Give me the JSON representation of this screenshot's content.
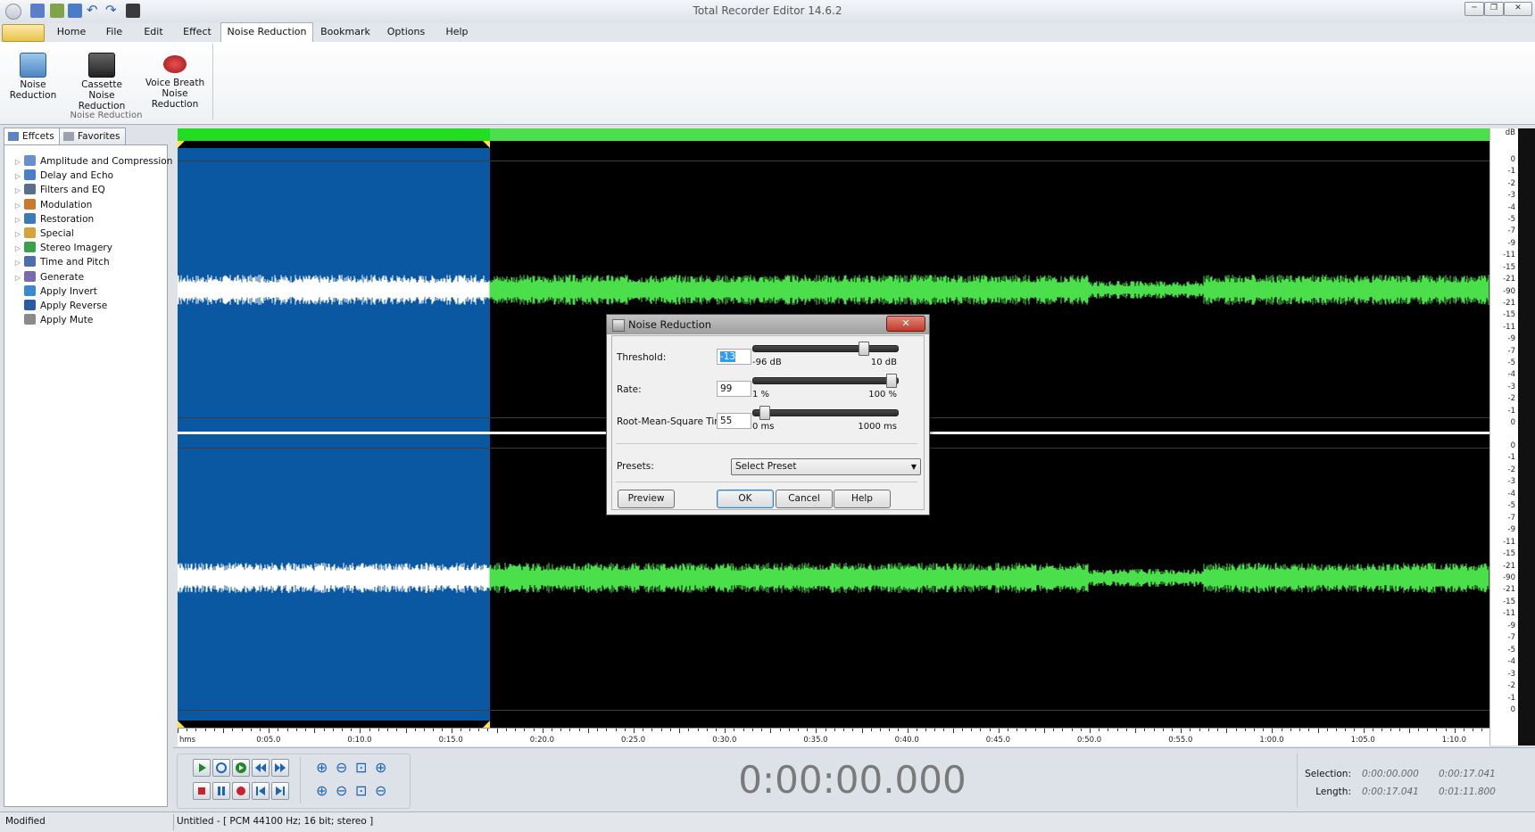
{
  "window": {
    "title": "Total Recorder Editor 14.6.2",
    "min_label": "─",
    "max_label": "❐",
    "close_label": "✕"
  },
  "ribbon": {
    "tabs": [
      "Home",
      "File",
      "Edit",
      "Effect",
      "Noise Reduction",
      "Bookmark",
      "Options",
      "Help"
    ],
    "active_tab": "Noise Reduction",
    "buttons": [
      {
        "label_1": "Noise",
        "label_2": "Reduction",
        "icon": "noise-reduction-icon"
      },
      {
        "label_1": "Cassette Noise",
        "label_2": "Reduction",
        "icon": "cassette-icon"
      },
      {
        "label_1": "Voice Breath",
        "label_2": "Noise Reduction",
        "icon": "lips-icon"
      }
    ],
    "group_label": "Noise Reduction"
  },
  "left_panel": {
    "tabs": [
      "Effcets",
      "Favorites"
    ],
    "items": [
      {
        "label": "Amplitude and Compression",
        "expandable": true
      },
      {
        "label": "Delay and Echo",
        "expandable": true
      },
      {
        "label": "Filters and EQ",
        "expandable": true
      },
      {
        "label": "Modulation",
        "expandable": true
      },
      {
        "label": "Restoration",
        "expandable": true
      },
      {
        "label": "Special",
        "expandable": true
      },
      {
        "label": "Stereo Imagery",
        "expandable": true
      },
      {
        "label": "Time and Pitch",
        "expandable": true
      },
      {
        "label": "Generate",
        "expandable": true
      },
      {
        "label": "Apply Invert",
        "expandable": false
      },
      {
        "label": "Apply Reverse",
        "expandable": false
      },
      {
        "label": "Apply Mute",
        "expandable": false
      }
    ]
  },
  "waveform": {
    "db_unit": "dB",
    "db_labels_top": [
      "0",
      "-1",
      "-2",
      "-3",
      "-4",
      "-5",
      "-7",
      "-9",
      "-11",
      "-15",
      "-21",
      "-90",
      "-21",
      "-15",
      "-11",
      "-9",
      "-7",
      "-5",
      "-4",
      "-3",
      "-2",
      "-1",
      "0"
    ],
    "db_labels_bottom": [
      "0",
      "-1",
      "-2",
      "-3",
      "-4",
      "-5",
      "-7",
      "-9",
      "-11",
      "-15",
      "-21",
      "-90",
      "-21",
      "-15",
      "-11",
      "-9",
      "-7",
      "-5",
      "-4",
      "-3",
      "-2",
      "-1",
      "0"
    ],
    "timeline_labels": [
      "hms",
      "0:05.0",
      "0:10.0",
      "0:15.0",
      "0:20.0",
      "0:25.0",
      "0:30.0",
      "0:35.0",
      "0:40.0",
      "0:45.0",
      "0:50.0",
      "0:55.0",
      "1:00.0",
      "1:05.0",
      "1:10.0"
    ],
    "colors": {
      "selection": "#0a57a2",
      "wave": "#4be04b",
      "wave_selected": "#ffffff",
      "background": "#000000"
    }
  },
  "transport": {
    "time_display": "0:00:00.000",
    "selection_label": "Selection:",
    "selection_start": "0:00:00.000",
    "selection_end": "0:00:17.041",
    "length_label": "Length:",
    "length_selection": "0:00:17.041",
    "length_total": "0:01:11.800"
  },
  "status": {
    "left": "Modified",
    "file": "Untitled - [ PCM 44100 Hz; 16 bit; stereo ]"
  },
  "dialog": {
    "title": "Noise Reduction",
    "close_label": "✕",
    "threshold": {
      "label": "Threshold:",
      "value": "-13",
      "min": "-96 dB",
      "max": "10 dB",
      "level": 0.78
    },
    "rate": {
      "label": "Rate:",
      "value": "99",
      "min": "1 %",
      "max": "100 %",
      "level": 0.99
    },
    "rms_time": {
      "label": "Root-Mean-Square Time:",
      "value": "55",
      "min": "0 ms",
      "max": "1000 ms",
      "level": 0.055
    },
    "presets_label": "Presets:",
    "preset_value": "Select Preset",
    "buttons": {
      "preview": "Preview",
      "ok": "OK",
      "cancel": "Cancel",
      "help": "Help"
    }
  }
}
